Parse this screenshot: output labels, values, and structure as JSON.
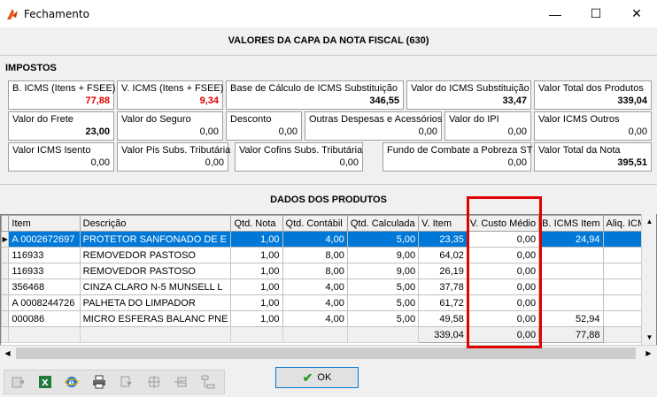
{
  "window": {
    "title": "Fechamento",
    "controls": {
      "minimize": "—",
      "maximize": "☐",
      "close": "✕"
    }
  },
  "header": {
    "title": "VALORES DA CAPA DA NOTA FISCAL (630)"
  },
  "impostos": {
    "label": "IMPOSTOS",
    "fields": [
      {
        "label": "B. ICMS (Itens + FSEE)",
        "value": "77,88",
        "value_color": "#e00000"
      },
      {
        "label": "V. ICMS (Itens + FSEE)",
        "value": "9,34",
        "value_color": "#e00000"
      },
      {
        "label": "Base de Cálculo de ICMS Substituição",
        "value": "346,55"
      },
      {
        "label": "Valor do ICMS Substituição",
        "value": "33,47"
      },
      {
        "label": "Valor Total dos Produtos",
        "value": "339,04"
      },
      {
        "label": "Valor do Frete",
        "value": "23,00"
      },
      {
        "label": "Valor do Seguro",
        "value": "0,00"
      },
      {
        "label": "Desconto",
        "value": "0,00"
      },
      {
        "label": "Outras Despesas e Acessórios",
        "value": "0,00"
      },
      {
        "label": "Valor do IPI",
        "value": "0,00"
      },
      {
        "label": "Valor ICMS Outros",
        "value": "0,00"
      },
      {
        "label": "Valor ICMS Isento",
        "value": "0,00"
      },
      {
        "label": "Valor Pis Subs. Tributária",
        "value": "0,00"
      },
      {
        "label": "Valor Cofins Subs. Tributária",
        "value": "0,00"
      },
      {
        "label": "Fundo de Combate a Pobreza ST",
        "value": "0,00"
      },
      {
        "label": "Valor Total da Nota",
        "value": "395,51"
      }
    ]
  },
  "produtos": {
    "label": "DADOS DOS PRODUTOS",
    "columns": [
      "Item",
      "Descrição",
      "Qtd. Nota",
      "Qtd. Contábil",
      "Qtd. Calculada",
      "V. Item",
      "V. Custo Médio",
      "B. ICMS Item",
      "Aliq. ICMS"
    ],
    "rows": [
      [
        "A  0002672697",
        "PROTETOR SANFONADO DE E",
        "1,00",
        "4,00",
        "5,00",
        "23,35",
        "0,00",
        "24,94",
        ""
      ],
      [
        "116933",
        "REMOVEDOR PASTOSO",
        "1,00",
        "8,00",
        "9,00",
        "64,02",
        "0,00",
        "",
        ""
      ],
      [
        "116933",
        "REMOVEDOR PASTOSO",
        "1,00",
        "8,00",
        "9,00",
        "26,19",
        "0,00",
        "",
        ""
      ],
      [
        "356468",
        "CINZA CLARO N-5 MUNSELL L",
        "1,00",
        "4,00",
        "5,00",
        "37,78",
        "0,00",
        "",
        ""
      ],
      [
        "A  0008244726",
        "PALHETA DO LIMPADOR",
        "1,00",
        "4,00",
        "5,00",
        "61,72",
        "0,00",
        "",
        ""
      ],
      [
        "000086",
        "MICRO ESFERAS BALANC PNE",
        "1,00",
        "4,00",
        "5,00",
        "49,58",
        "0,00",
        "52,94",
        ""
      ]
    ],
    "totals": {
      "v_item": "339,04",
      "v_custo_medio": "0,00",
      "b_icms_item": "77,88"
    },
    "selected_row_indicator": "▶"
  },
  "toolbar": {
    "buttons": [
      "export-icon",
      "excel-icon",
      "internet-explorer-icon",
      "print-icon",
      "filter-icon",
      "config-icon",
      "move-left-icon",
      "tree-icon"
    ]
  },
  "footer": {
    "ok_label": "OK"
  }
}
